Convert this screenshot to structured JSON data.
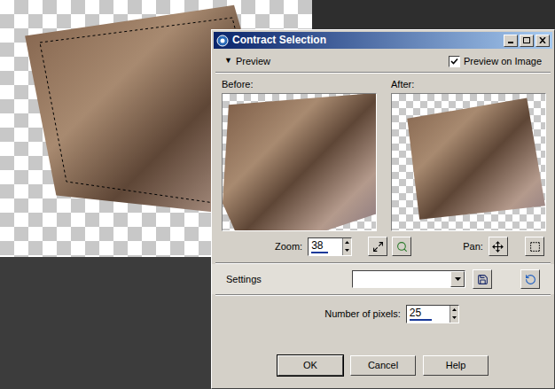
{
  "window": {
    "title": "Contract Selection"
  },
  "preview": {
    "toggle": "▼",
    "label": "Preview",
    "expanded": true,
    "on_image": {
      "label": "Preview on Image",
      "checked": true
    }
  },
  "before": {
    "label": "Before:"
  },
  "after": {
    "label": "After:"
  },
  "zoom": {
    "label": "Zoom:",
    "value": "38"
  },
  "pan": {
    "label": "Pan:"
  },
  "settings": {
    "label": "Settings"
  },
  "pixels": {
    "label": "Number of pixels:",
    "value": "25"
  },
  "buttons": [
    {
      "label": "OK",
      "default": true
    },
    {
      "label": "Cancel",
      "default": false
    },
    {
      "label": "Help",
      "default": false
    }
  ]
}
